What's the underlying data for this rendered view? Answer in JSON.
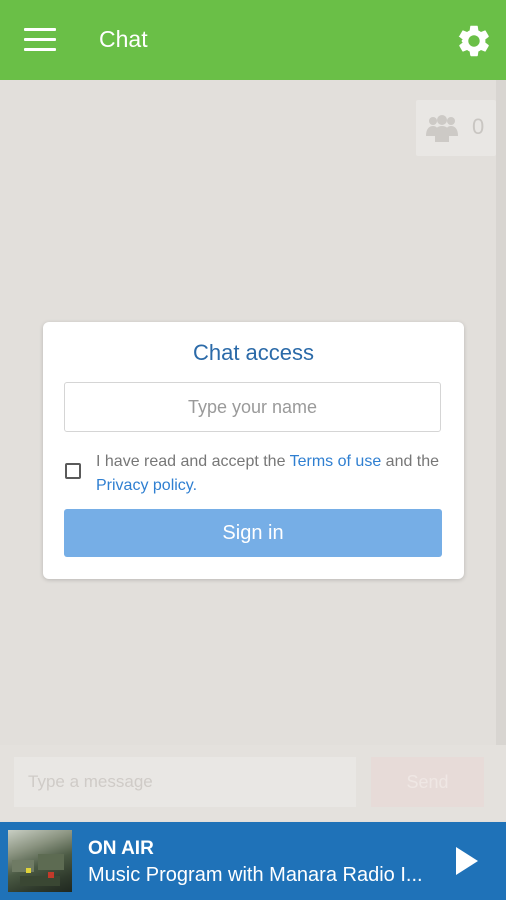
{
  "appbar": {
    "title": "Chat",
    "menu_icon": "hamburger-menu-icon",
    "settings_icon": "gear-icon",
    "color": "#6abf47"
  },
  "users": {
    "icon": "users-group-icon",
    "count": "0"
  },
  "chat_access": {
    "title": "Chat access",
    "name_placeholder": "Type your name",
    "name_value": "",
    "checkbox_checked": false,
    "terms_prefix": "I have read and accept the ",
    "terms_link": "Terms of use",
    "terms_middle": " and the ",
    "privacy_link": "Privacy policy",
    "terms_suffix": ".",
    "signin_label": "Sign in",
    "accent": "#2f7fd1",
    "button_color": "#76aee6"
  },
  "composer": {
    "placeholder": "Type a message",
    "send_label": "Send"
  },
  "player": {
    "status": "ON AIR",
    "track": "Music Program with Manara Radio I...",
    "play_icon": "play-icon",
    "color": "#1f72b8"
  }
}
